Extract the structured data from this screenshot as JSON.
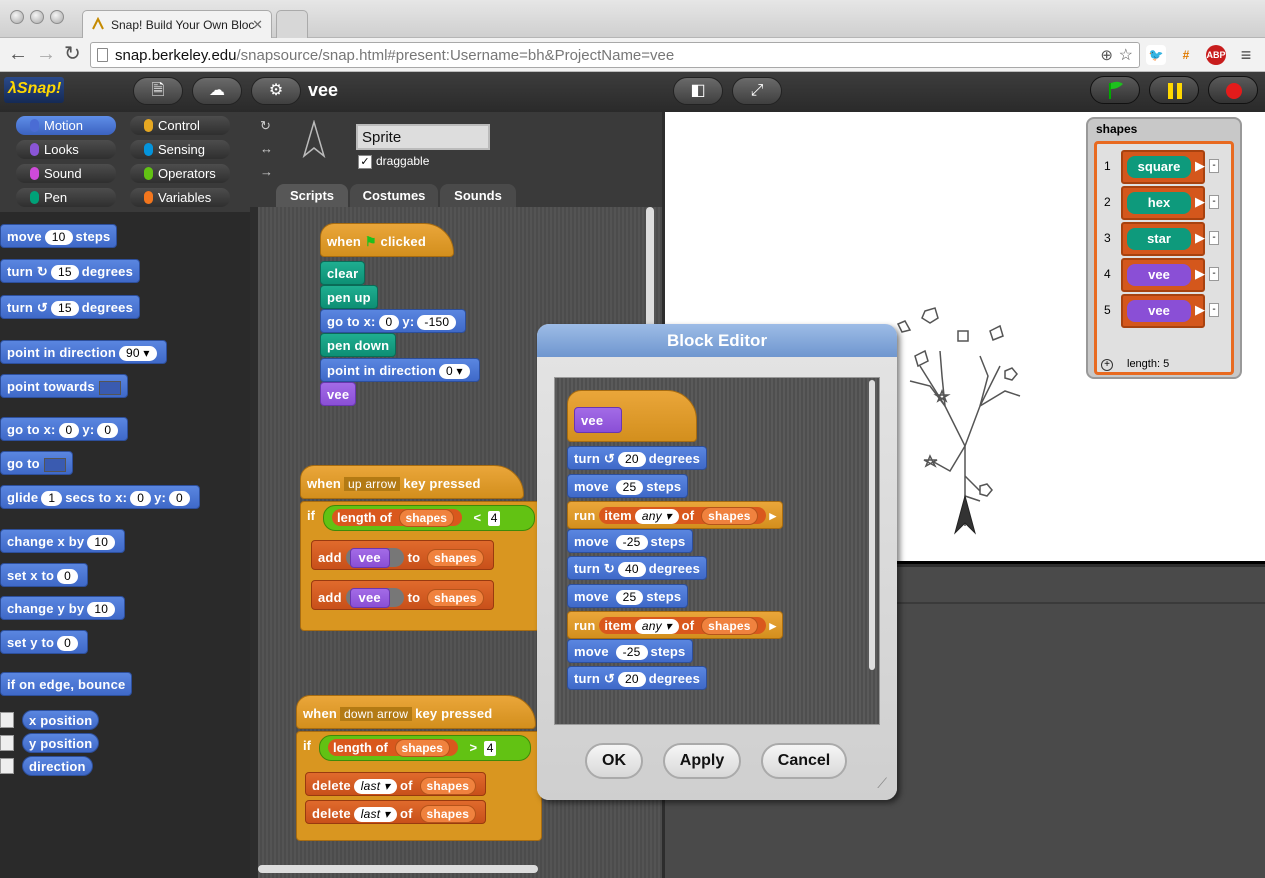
{
  "browser": {
    "tab_title": "Snap! Build Your Own Bloc",
    "url_host": "snap.berkeley.edu",
    "url_path": "/snapsource/snap.html#present:Username=bh&ProjectName=vee"
  },
  "snap": {
    "logo": "λSnap!",
    "project_name": "vee",
    "categories": [
      {
        "label": "Motion",
        "color": "#4a6cd4"
      },
      {
        "label": "Control",
        "color": "#e6a822"
      },
      {
        "label": "Looks",
        "color": "#8a55d7"
      },
      {
        "label": "Sensing",
        "color": "#0494dc"
      },
      {
        "label": "Sound",
        "color": "#cf4ad9"
      },
      {
        "label": "Operators",
        "color": "#62c213"
      },
      {
        "label": "Pen",
        "color": "#00a178"
      },
      {
        "label": "Variables",
        "color": "#f3761d"
      }
    ]
  },
  "palette": {
    "move": {
      "pre": "move",
      "val": "10",
      "post": "steps"
    },
    "turn_cw": {
      "pre": "turn",
      "icon": "↻",
      "val": "15",
      "post": "degrees"
    },
    "turn_ccw": {
      "pre": "turn",
      "icon": "↺",
      "val": "15",
      "post": "degrees"
    },
    "point_dir": {
      "pre": "point in direction",
      "val": "90"
    },
    "point_towards": {
      "pre": "point towards"
    },
    "goto_xy": {
      "pre": "go to x:",
      "x": "0",
      "mid": "y:",
      "y": "0"
    },
    "goto": {
      "pre": "go to"
    },
    "glide": {
      "pre": "glide",
      "val": "1",
      "mid": "secs to x:",
      "x": "0",
      "mid2": "y:",
      "y": "0"
    },
    "change_x": {
      "pre": "change x by",
      "val": "10"
    },
    "set_x": {
      "pre": "set x to",
      "val": "0"
    },
    "change_y": {
      "pre": "change y by",
      "val": "10"
    },
    "set_y": {
      "pre": "set y to",
      "val": "0"
    },
    "bounce": "if on edge, bounce",
    "reporters": [
      "x position",
      "y position",
      "direction"
    ]
  },
  "sprite": {
    "name": "Sprite",
    "draggable_label": "draggable",
    "tabs": [
      "Scripts",
      "Costumes",
      "Sounds"
    ]
  },
  "script1": {
    "hat": {
      "pre": "when",
      "post": "clicked"
    },
    "clear": "clear",
    "pen_up": "pen up",
    "goto": {
      "pre": "go to x:",
      "x": "0",
      "mid": "y:",
      "y": "-150"
    },
    "pen_down": "pen down",
    "point": {
      "pre": "point in direction",
      "val": "0"
    },
    "vee": "vee"
  },
  "script2": {
    "hat": {
      "pre": "when",
      "key": "up arrow",
      "post": "key pressed"
    },
    "if": "if",
    "length_of": "length of",
    "shapes": "shapes",
    "op": "<",
    "num": "4",
    "add": "add",
    "to": "to",
    "vee": "vee"
  },
  "script3": {
    "hat": {
      "pre": "when",
      "key": "down arrow",
      "post": "key pressed"
    },
    "if": "if",
    "length_of": "length of",
    "shapes": "shapes",
    "op": ">",
    "num": "4",
    "delete": "delete",
    "last": "last",
    "of": "of"
  },
  "watcher": {
    "label": "shapes",
    "items": [
      {
        "n": "1",
        "name": "square",
        "color": "#0e9a7c"
      },
      {
        "n": "2",
        "name": "hex",
        "color": "#0e9a7c"
      },
      {
        "n": "3",
        "name": "star",
        "color": "#0e9a7c"
      },
      {
        "n": "4",
        "name": "vee",
        "color": "#8a4fd6"
      },
      {
        "n": "5",
        "name": "vee",
        "color": "#8a4fd6"
      }
    ],
    "length_label": "length: 5"
  },
  "block_editor": {
    "title": "Block Editor",
    "hat": "vee",
    "lines": [
      {
        "kind": "motion",
        "pre": "turn",
        "icon": "↺",
        "val": "20",
        "post": "degrees"
      },
      {
        "kind": "motion",
        "pre": "move",
        "val": "25",
        "post": "steps"
      },
      {
        "kind": "run",
        "pre": "run",
        "item": "item",
        "any": "any",
        "of": "of",
        "list": "shapes"
      },
      {
        "kind": "motion",
        "pre": "move",
        "val": "-25",
        "post": "steps"
      },
      {
        "kind": "motion",
        "pre": "turn",
        "icon": "↻",
        "val": "40",
        "post": "degrees"
      },
      {
        "kind": "motion",
        "pre": "move",
        "val": "25",
        "post": "steps"
      },
      {
        "kind": "run",
        "pre": "run",
        "item": "item",
        "any": "any",
        "of": "of",
        "list": "shapes"
      },
      {
        "kind": "motion",
        "pre": "move",
        "val": "-25",
        "post": "steps"
      },
      {
        "kind": "motion",
        "pre": "turn",
        "icon": "↺",
        "val": "20",
        "post": "degrees"
      }
    ],
    "ok": "OK",
    "apply": "Apply",
    "cancel": "Cancel"
  },
  "colors": {
    "motion": "#4a6cd4",
    "pen": "#00a178",
    "control": "#e6a822",
    "list": "#d9581d",
    "custom": "#8a4fd6"
  }
}
